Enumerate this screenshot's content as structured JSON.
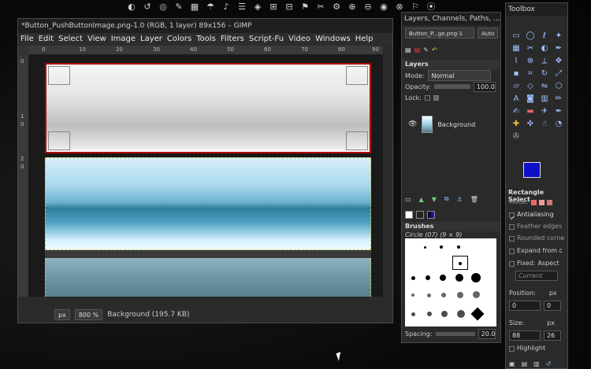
{
  "taskbar": {
    "icons": [
      "app-icon-1",
      "app-icon-2",
      "app-icon-3",
      "app-icon-4",
      "app-icon-5",
      "app-icon-6",
      "app-icon-7",
      "app-icon-8",
      "app-icon-9",
      "app-icon-10",
      "app-icon-11",
      "app-icon-12",
      "app-icon-13",
      "app-icon-14",
      "app-icon-15",
      "app-icon-16",
      "app-icon-17",
      "app-icon-18",
      "app-icon-19",
      "app-icon-20",
      "app-icon-21",
      "app-icon-22"
    ]
  },
  "gimp": {
    "title": "*Button_PushButtonImage.png-1.0 (RGB, 1 layer) 89x156 – GIMP",
    "menu": [
      "File",
      "Edit",
      "Select",
      "View",
      "Image",
      "Layer",
      "Colors",
      "Tools",
      "Filters",
      "Script-Fu",
      "Video",
      "Windows",
      "Help"
    ],
    "hruler": [
      "0",
      "10",
      "20",
      "30",
      "40",
      "50",
      "60",
      "70",
      "80",
      "90"
    ],
    "vruler": [
      "0",
      "1",
      "0",
      "2",
      "0"
    ],
    "status": {
      "unit": "px",
      "zoom": "800 %",
      "info": "Background (195.7 KB)"
    }
  },
  "layers": {
    "title": "Layers, Channels, Paths, ...",
    "image_select": "Button_P...ge.png-1",
    "auto": "Auto",
    "section": "Layers",
    "mode_label": "Mode:",
    "mode_value": "Normal",
    "opacity_label": "Opacity:",
    "opacity_value": "100.0",
    "lock_label": "Lock:",
    "layer_name": "Background",
    "brushes_section": "Brushes",
    "brush_name": "Circle (07) (9 × 9)",
    "spacing_label": "Spacing:",
    "spacing_value": "20.0"
  },
  "toolbox": {
    "title": "Toolbox",
    "tool_options_title": "Rectangle Select",
    "mode_label": "Mode:",
    "antialiasing": "Antialiasing",
    "feather": "Feather edges",
    "rounded": "Rounded corne",
    "expand": "Expand from c",
    "fixed": "Fixed:",
    "aspect": "Aspect",
    "current": "Current",
    "position_label": "Position:",
    "position_unit": "px",
    "position_x": "0",
    "position_y": "0",
    "size_label": "Size:",
    "size_unit": "px",
    "size_w": "88",
    "size_h": "26",
    "highlight": "Highlight",
    "fg_color": "#1010c8",
    "bg_color": "#b00000"
  }
}
